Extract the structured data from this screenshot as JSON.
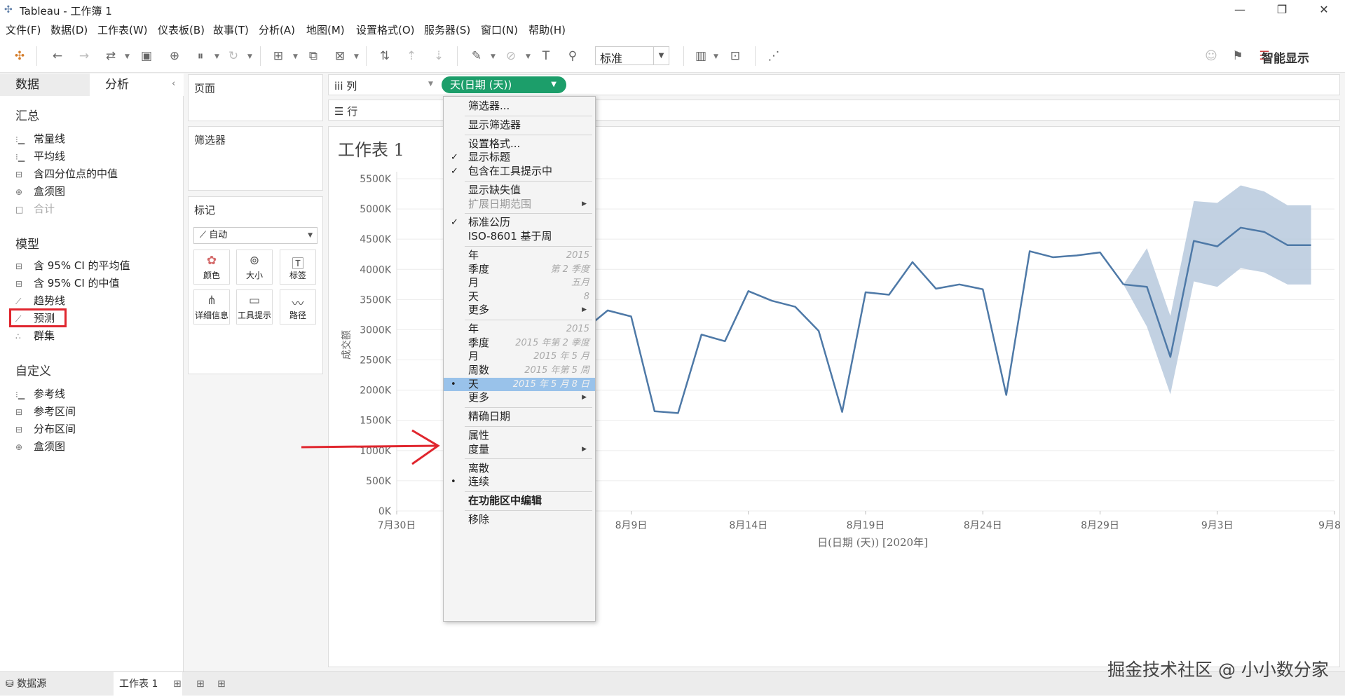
{
  "window": {
    "title": "Tableau - 工作簿 1",
    "min": "—",
    "restore": "❐",
    "close": "✕"
  },
  "menu": [
    "文件(F)",
    "数据(D)",
    "工作表(W)",
    "仪表板(B)",
    "故事(T)",
    "分析(A)",
    "地图(M)",
    "设置格式(O)",
    "服务器(S)",
    "窗口(N)",
    "帮助(H)"
  ],
  "toolbar": {
    "fit_value": "标准",
    "show_me_label": "智能显示"
  },
  "left_pane": {
    "tabs": [
      "数据",
      "分析"
    ],
    "sections": [
      {
        "title": "汇总",
        "items": [
          {
            "label": "常量线",
            "icon": "line-icon",
            "enabled": true
          },
          {
            "label": "平均线",
            "icon": "line-icon",
            "enabled": true
          },
          {
            "label": "含四分位点的中值",
            "icon": "band-icon",
            "enabled": true
          },
          {
            "label": "盒须图",
            "icon": "boxplot-icon",
            "enabled": true
          },
          {
            "label": "合计",
            "icon": "total-icon",
            "enabled": false
          }
        ]
      },
      {
        "title": "模型",
        "items": [
          {
            "label": "含 95% CI 的平均值",
            "icon": "band-icon",
            "enabled": true
          },
          {
            "label": "含 95% CI 的中值",
            "icon": "band-icon",
            "enabled": true
          },
          {
            "label": "趋势线",
            "icon": "trend-icon",
            "enabled": true
          },
          {
            "label": "预测",
            "icon": "forecast-icon",
            "enabled": true
          },
          {
            "label": "群集",
            "icon": "cluster-icon",
            "enabled": true
          }
        ]
      },
      {
        "title": "自定义",
        "items": [
          {
            "label": "参考线",
            "icon": "line-icon",
            "enabled": true
          },
          {
            "label": "参考区间",
            "icon": "band-icon",
            "enabled": true
          },
          {
            "label": "分布区间",
            "icon": "band-icon",
            "enabled": true
          },
          {
            "label": "盒须图",
            "icon": "boxplot-icon",
            "enabled": true
          }
        ]
      }
    ]
  },
  "cards": {
    "pages": "页面",
    "filters": "筛选器",
    "marks": "标记",
    "mark_type": "自动",
    "mark_buttons": [
      "颜色",
      "大小",
      "标签",
      "详细信息",
      "工具提示",
      "路径"
    ]
  },
  "shelves": {
    "columns": "列",
    "rows": "行",
    "pill": "天(日期 (天))"
  },
  "sheet_title": "工作表 1",
  "context_menu": [
    {
      "label": "筛选器...",
      "hint": "",
      "check": "",
      "arrow": false,
      "state": "normal"
    },
    {
      "sep": true
    },
    {
      "label": "显示筛选器",
      "hint": "",
      "check": "",
      "arrow": false,
      "state": "normal"
    },
    {
      "sep": true
    },
    {
      "label": "设置格式...",
      "hint": "",
      "check": "",
      "arrow": false,
      "state": "normal"
    },
    {
      "label": "显示标题",
      "hint": "",
      "check": "✓",
      "arrow": false,
      "state": "normal"
    },
    {
      "label": "包含在工具提示中",
      "hint": "",
      "check": "✓",
      "arrow": false,
      "state": "normal"
    },
    {
      "sep": true
    },
    {
      "label": "显示缺失值",
      "hint": "",
      "check": "",
      "arrow": false,
      "state": "normal"
    },
    {
      "label": "扩展日期范围",
      "hint": "",
      "check": "",
      "arrow": true,
      "state": "disabled"
    },
    {
      "sep": true
    },
    {
      "label": "标准公历",
      "hint": "",
      "check": "✓",
      "arrow": false,
      "state": "normal"
    },
    {
      "label": "ISO-8601 基于周",
      "hint": "",
      "check": "",
      "arrow": false,
      "state": "normal"
    },
    {
      "sep": true
    },
    {
      "label": "年",
      "hint": "2015",
      "check": "",
      "arrow": false,
      "state": "normal"
    },
    {
      "label": "季度",
      "hint": "第 2 季度",
      "check": "",
      "arrow": false,
      "state": "normal"
    },
    {
      "label": "月",
      "hint": "五月",
      "check": "",
      "arrow": false,
      "state": "normal"
    },
    {
      "label": "天",
      "hint": "8",
      "check": "",
      "arrow": false,
      "state": "normal"
    },
    {
      "label": "更多",
      "hint": "",
      "check": "",
      "arrow": true,
      "state": "normal"
    },
    {
      "sep": true
    },
    {
      "label": "年",
      "hint": "2015",
      "check": "",
      "arrow": false,
      "state": "normal"
    },
    {
      "label": "季度",
      "hint": "2015 年第 2 季度",
      "check": "",
      "arrow": false,
      "state": "normal"
    },
    {
      "label": "月",
      "hint": "2015 年 5 月",
      "check": "",
      "arrow": false,
      "state": "normal"
    },
    {
      "label": "周数",
      "hint": "2015 年第 5 周",
      "check": "",
      "arrow": false,
      "state": "normal"
    },
    {
      "label": "天",
      "hint": "2015 年 5 月 8 日",
      "check": "•",
      "arrow": false,
      "state": "highlighted"
    },
    {
      "label": "更多",
      "hint": "",
      "check": "",
      "arrow": true,
      "state": "normal"
    },
    {
      "sep": true
    },
    {
      "label": "精确日期",
      "hint": "",
      "check": "",
      "arrow": false,
      "state": "normal"
    },
    {
      "sep": true
    },
    {
      "label": "属性",
      "hint": "",
      "check": "",
      "arrow": false,
      "state": "normal"
    },
    {
      "label": "度量",
      "hint": "",
      "check": "",
      "arrow": true,
      "state": "normal"
    },
    {
      "sep": true
    },
    {
      "label": "离散",
      "hint": "",
      "check": "",
      "arrow": false,
      "state": "normal"
    },
    {
      "label": "连续",
      "hint": "",
      "check": "•",
      "arrow": false,
      "state": "normal"
    },
    {
      "sep": true
    },
    {
      "label": "在功能区中编辑",
      "hint": "",
      "check": "",
      "arrow": false,
      "state": "bold"
    },
    {
      "sep": true
    },
    {
      "label": "移除",
      "hint": "",
      "check": "",
      "arrow": false,
      "state": "normal"
    }
  ],
  "chart_data": {
    "type": "line",
    "ylabel": "成交额",
    "xlabel": "日(日期 (天)) [2020年]",
    "yticks": [
      "0K",
      "500K",
      "1000K",
      "1500K",
      "2000K",
      "2500K",
      "3000K",
      "3500K",
      "4000K",
      "4500K",
      "5000K",
      "5500K"
    ],
    "ylim": [
      0,
      5500
    ],
    "xticks": [
      "7月30日",
      "8月4日",
      "8月9日",
      "8月14日",
      "8月19日",
      "8月24日",
      "8月29日",
      "9月3日",
      "9月8日"
    ],
    "xlim_days": [
      0,
      40
    ],
    "line_color": "#4e79a7",
    "band_color": "#b7c9dd",
    "series": [
      {
        "name": "actual",
        "x": [
          8,
          9,
          10,
          11,
          12,
          13,
          14,
          15,
          16,
          17,
          18,
          19,
          20,
          21,
          22,
          23,
          24,
          25,
          26,
          27,
          28,
          29,
          30,
          31
        ],
        "y": [
          3000,
          3320,
          3220,
          1650,
          1620,
          2920,
          2810,
          3640,
          3480,
          3380,
          2980,
          1640,
          3620,
          3580,
          4120,
          3680,
          3750,
          3670,
          1920,
          4300,
          4200,
          4230,
          4280,
          3750
        ]
      },
      {
        "name": "forecast",
        "x": [
          31,
          32,
          33,
          34,
          35,
          36,
          37,
          38,
          39
        ],
        "y": [
          3750,
          3710,
          2550,
          4470,
          4380,
          4690,
          4620,
          4400,
          4400
        ],
        "upper": [
          3750,
          4350,
          3230,
          5130,
          5100,
          5390,
          5290,
          5060,
          5060
        ],
        "lower": [
          3750,
          3050,
          1930,
          3800,
          3710,
          4020,
          3950,
          3750,
          3750
        ]
      }
    ]
  },
  "bottom_tabs": [
    "数据源",
    "工作表 1"
  ],
  "watermark": "掘金技术社区 @ 小小数分家"
}
